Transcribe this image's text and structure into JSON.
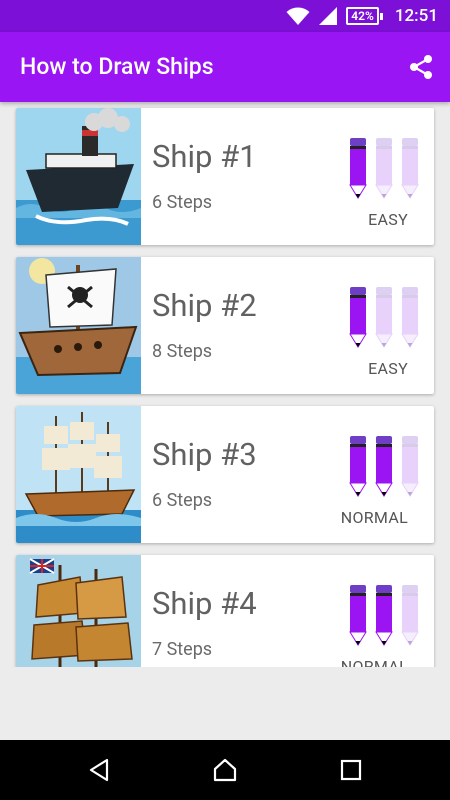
{
  "status_bar": {
    "battery": "42%",
    "time": "12:51",
    "icons": [
      "wifi-icon",
      "cell-signal-icon",
      "battery-icon"
    ]
  },
  "app_bar": {
    "title": "How to Draw Ships",
    "share_icon": "share-icon"
  },
  "ships": [
    {
      "title": "Ship #1",
      "steps": "6 Steps",
      "difficulty": "EASY",
      "filled_pencils": 1
    },
    {
      "title": "Ship #2",
      "steps": "8 Steps",
      "difficulty": "EASY",
      "filled_pencils": 1
    },
    {
      "title": "Ship #3",
      "steps": "6 Steps",
      "difficulty": "NORMAL",
      "filled_pencils": 2
    },
    {
      "title": "Ship #4",
      "steps": "7 Steps",
      "difficulty": "NORMAL",
      "filled_pencils": 2
    }
  ],
  "nav_bar": {
    "icons": [
      "back-icon",
      "home-icon",
      "recents-icon"
    ]
  },
  "colors": {
    "status_bar": "#7c10d6",
    "app_bar": "#9a15f3",
    "pencil_filled": "#9b15f3",
    "pencil_empty": "#e8d2fb"
  }
}
